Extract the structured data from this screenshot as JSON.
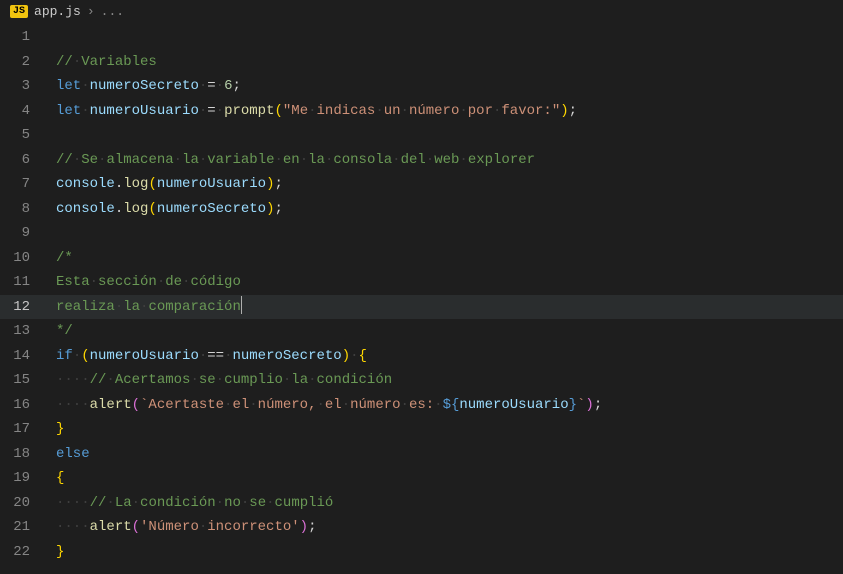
{
  "breadcrumb": {
    "js_badge": "JS",
    "filename": "app.js",
    "ellipsis": "..."
  },
  "editor": {
    "current_line": 12,
    "lines": {
      "2": {
        "c1": "//",
        "c2": "Variables"
      },
      "3": {
        "kw": "let",
        "var": "numeroSecreto",
        "num": "6"
      },
      "4": {
        "kw": "let",
        "var": "numeroUsuario",
        "fn": "prompt",
        "str": "\"Me",
        "str2": "indicas",
        "str3": "un",
        "str4": "número",
        "str5": "por",
        "str6": "favor:\""
      },
      "6": {
        "c1": "//",
        "c2": "Se",
        "c3": "almacena",
        "c4": "la",
        "c5": "variable",
        "c6": "en",
        "c7": "la",
        "c8": "consola",
        "c9": "del",
        "c10": "web",
        "c11": "explorer"
      },
      "7": {
        "obj": "console",
        "fn": "log",
        "arg": "numeroUsuario"
      },
      "8": {
        "obj": "console",
        "fn": "log",
        "arg": "numeroSecreto"
      },
      "10": {
        "c": "/*"
      },
      "11": {
        "c1": "Esta",
        "c2": "sección",
        "c3": "de",
        "c4": "código"
      },
      "12": {
        "c1": "realiza",
        "c2": "la",
        "c3": "comparación"
      },
      "13": {
        "c": "*/"
      },
      "14": {
        "kw": "if",
        "v1": "numeroUsuario",
        "v2": "numeroSecreto"
      },
      "15": {
        "c1": "//",
        "c2": "Acertamos",
        "c3": "se",
        "c4": "cumplio",
        "c5": "la",
        "c6": "condición"
      },
      "16": {
        "fn": "alert",
        "s1": "`Acertaste",
        "s2": "el",
        "s3": "número,",
        "s4": "el",
        "s5": "número",
        "s6": "es:",
        "interp": "numeroUsuario",
        "s7": "`"
      },
      "17": {
        "br": "}"
      },
      "18": {
        "kw": "else"
      },
      "19": {
        "br": "{"
      },
      "20": {
        "c1": "//",
        "c2": "La",
        "c3": "condición",
        "c4": "no",
        "c5": "se",
        "c6": "cumplió"
      },
      "21": {
        "fn": "alert",
        "str": "'Número",
        "str2": "incorrecto'"
      },
      "22": {
        "br": "}"
      }
    }
  }
}
